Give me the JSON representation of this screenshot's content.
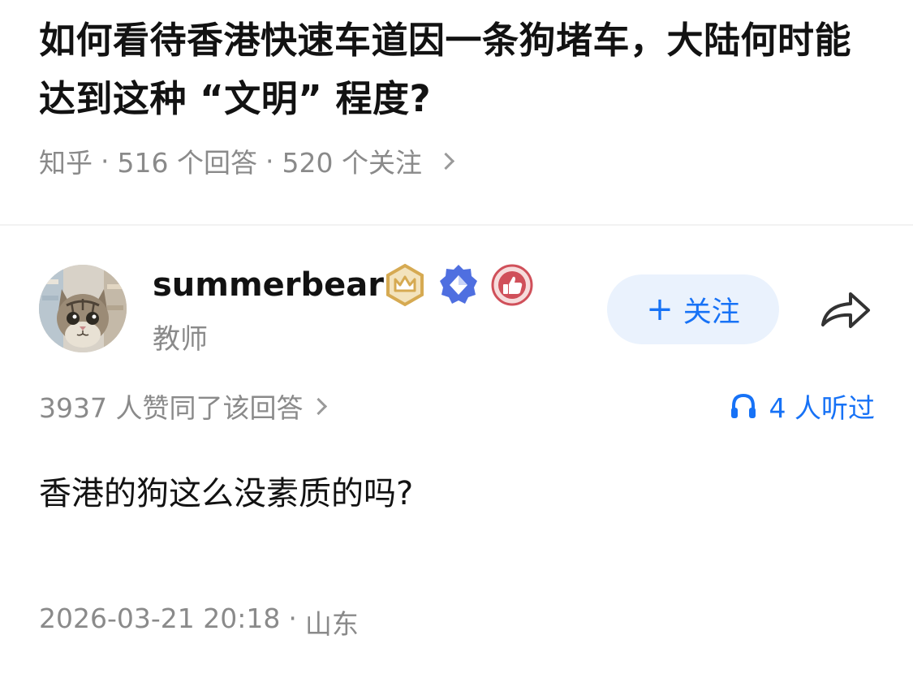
{
  "question": {
    "title": "如何看待香港快速车道因一条狗堵车，大陆何时能达到这种 “文明” 程度?",
    "source": "知乎",
    "answer_count": "516 个回答",
    "follow_count": "520 个关注",
    "separator": "·"
  },
  "author": {
    "name": "summerbear",
    "role": "教师",
    "follow_label": "关注",
    "follow_plus": "+",
    "badges": [
      "crown-badge-icon",
      "diamond-badge-icon",
      "thumbs-up-badge-icon"
    ]
  },
  "stats": {
    "likes": "3937 人赞同了该回答",
    "listeners": "4 人听过"
  },
  "answer": {
    "content": "香港的狗这么没素质的吗?"
  },
  "footer": {
    "timestamp": "2026-03-21 20:18",
    "separator": "·",
    "location": "山东"
  },
  "colors": {
    "primary_blue": "#1772f6",
    "follow_bg": "#eaf2fd",
    "meta_gray": "#8a8a8a",
    "text": "#121212",
    "badge_gold": "#d6aa52",
    "badge_blue": "#4f6fe0",
    "badge_red": "#d0505a"
  }
}
